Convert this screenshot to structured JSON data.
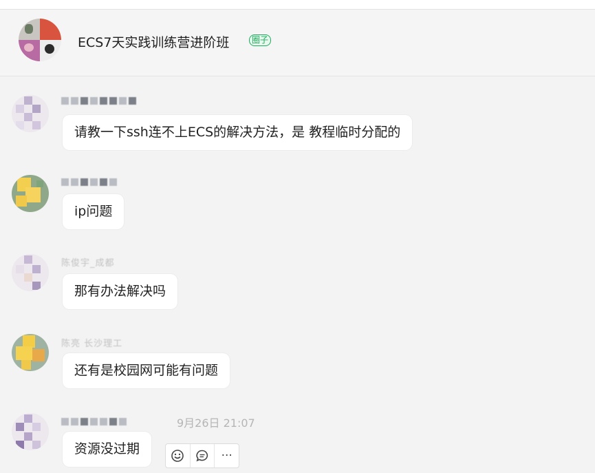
{
  "header": {
    "group_name": "ECS7天实践训练营进阶班",
    "badge": "圈子"
  },
  "messages": [
    {
      "sender": "陈俊宇_成都",
      "text": "请教一下ssh连不上ECS的解决方法，是 教程临时分配的"
    },
    {
      "sender": "",
      "text": "ip问题"
    },
    {
      "sender": "陈俊宇_成都",
      "text": "那有办法解决吗"
    },
    {
      "sender": "陈亮 长沙理工",
      "text": "还有是校园网可能有问题"
    },
    {
      "sender": "",
      "text": "资源没过期",
      "time": "9月26日 21:07"
    }
  ],
  "hover_actions": [
    {
      "name": "emoji-icon"
    },
    {
      "name": "comment-icon"
    },
    {
      "name": "more-icon",
      "label": "···"
    }
  ]
}
